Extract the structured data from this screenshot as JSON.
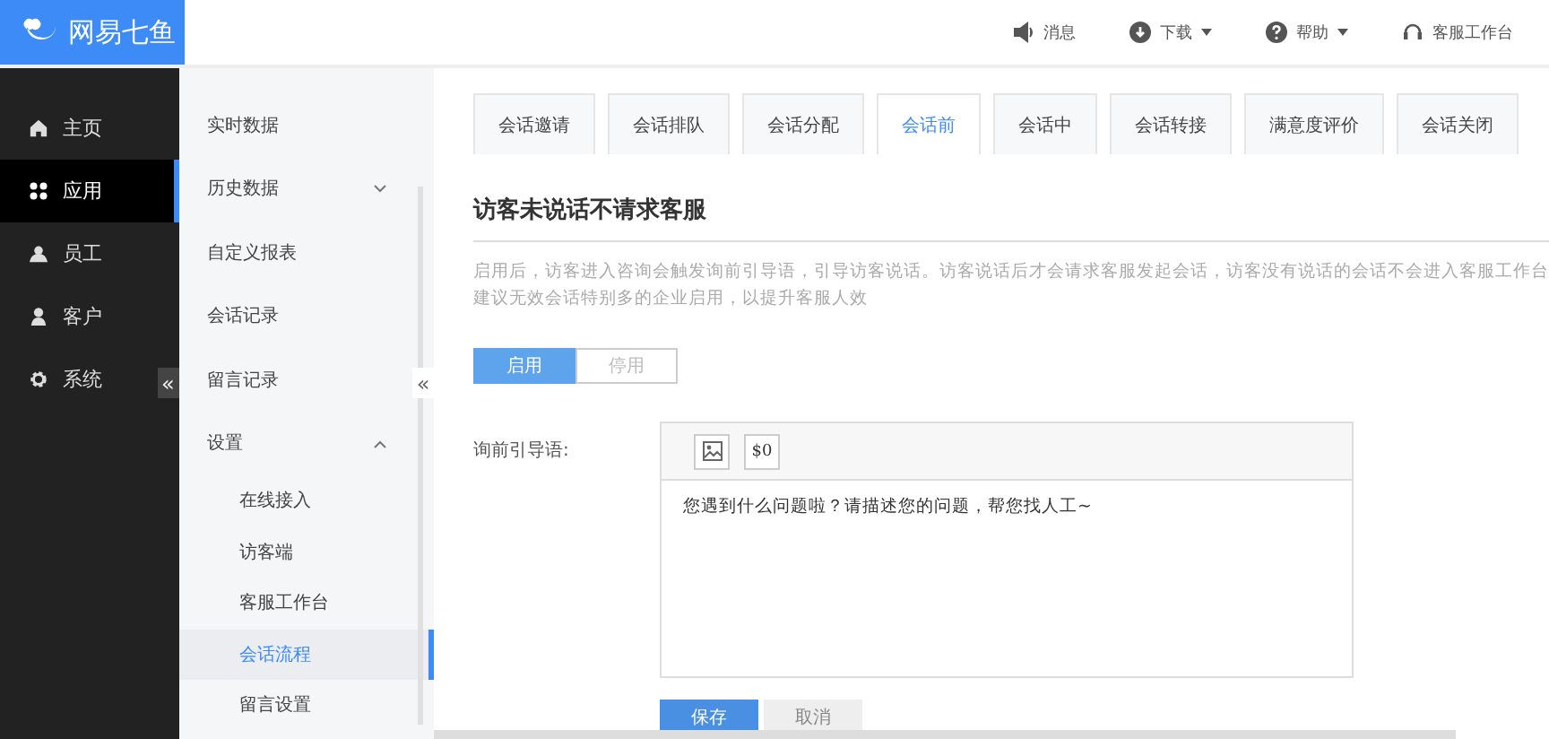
{
  "logo": {
    "text": "网易七鱼"
  },
  "header": {
    "items": [
      {
        "kind": "speaker",
        "label": "消息",
        "dropdown": false
      },
      {
        "kind": "download",
        "label": "下载",
        "dropdown": true
      },
      {
        "kind": "help",
        "label": "帮助",
        "dropdown": true
      },
      {
        "kind": "headset",
        "label": "客服工作台",
        "dropdown": false
      }
    ]
  },
  "nav": {
    "items": [
      {
        "kind": "home",
        "label": "主页",
        "selected": false
      },
      {
        "kind": "apps",
        "label": "应用",
        "selected": true
      },
      {
        "kind": "staff",
        "label": "员工",
        "selected": false
      },
      {
        "kind": "customer",
        "label": "客户",
        "selected": false
      },
      {
        "kind": "gear",
        "label": "系统",
        "selected": false
      }
    ],
    "collapse": "«"
  },
  "submenu": {
    "items": [
      {
        "label": "实时数据",
        "selected": false
      },
      {
        "label": "历史数据",
        "selected": false,
        "expanded": false
      },
      {
        "label": "自定义报表",
        "selected": false
      },
      {
        "label": "会话记录",
        "selected": false
      },
      {
        "label": "留言记录",
        "selected": false
      },
      {
        "label": "设置",
        "selected": false,
        "expanded": true,
        "children": [
          {
            "label": "在线接入",
            "selected": false
          },
          {
            "label": "访客端",
            "selected": false
          },
          {
            "label": "客服工作台",
            "selected": false
          },
          {
            "label": "会话流程",
            "selected": true
          },
          {
            "label": "留言设置",
            "selected": false
          }
        ]
      }
    ],
    "collapse": "«"
  },
  "tabs": [
    {
      "label": "会话邀请",
      "selected": false
    },
    {
      "label": "会话排队",
      "selected": false
    },
    {
      "label": "会话分配",
      "selected": false
    },
    {
      "label": "会话前",
      "selected": true
    },
    {
      "label": "会话中",
      "selected": false
    },
    {
      "label": "会话转接",
      "selected": false
    },
    {
      "label": "满意度评价",
      "selected": false
    },
    {
      "label": "会话关闭",
      "selected": false
    }
  ],
  "section": {
    "title": "访客未说话不请求客服",
    "description": [
      "启用后，访客进入咨询会触发询前引导语，引导访客说话。访客说话后才会请求客服发起会话，访客没有说话的会话不会进入客服工作台",
      "建议无效会话特别多的企业启用，以提升客服人效"
    ],
    "toggle": [
      {
        "label": "启用",
        "selected": true
      },
      {
        "label": "停用",
        "selected": false
      }
    ],
    "field_label": "询前引导语:",
    "editor": {
      "toolbar": [
        {
          "kind": "image"
        },
        {
          "kind": "text",
          "label": "$0"
        }
      ],
      "value": "您遇到什么问题啦？请描述您的问题，帮您找人工~"
    },
    "buttons": [
      {
        "label": "保存",
        "kind": "primary"
      },
      {
        "label": "取消",
        "kind": "default"
      }
    ]
  }
}
